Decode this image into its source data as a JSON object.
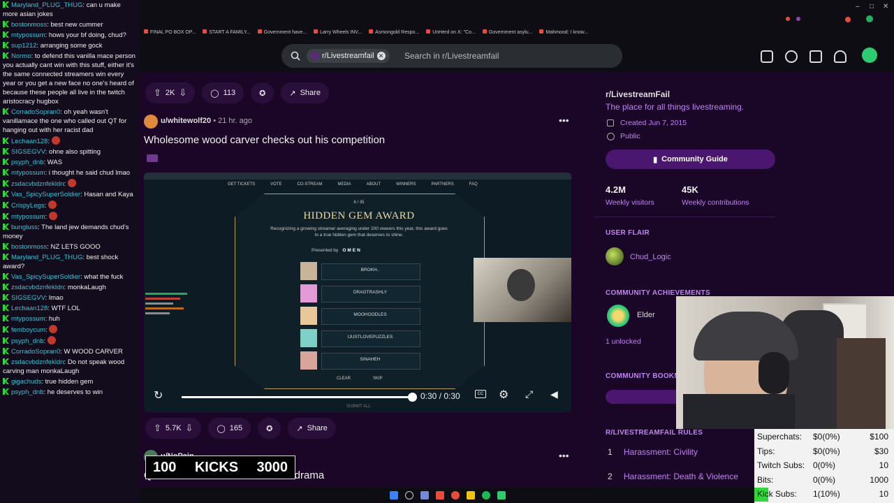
{
  "chat": {
    "messages": [
      {
        "user": "Maryland_PLUG_THUG",
        "text": "can u make more asian jokes"
      },
      {
        "user": "bostonmoss",
        "text": "best new cummer"
      },
      {
        "user": "mtypossum",
        "text": "hows your bf doing, chud?"
      },
      {
        "user": "sup1212",
        "text": "arranging some gock"
      },
      {
        "user": "Normo",
        "text": "to defend this vanilla mace person you actually cant win with this stuff, either it's the same connected streamers win every year or you get a new face no one's heard of because these people all live in the twitch aristocracy hugbox"
      },
      {
        "user": "CorradoSopran0",
        "text": "oh yeah wasn't vanillamace the one who called out QT for hanging out with her racist dad"
      },
      {
        "user": "Lechaan128",
        "text": ""
      },
      {
        "user": "SIGSEGVV",
        "text": "ohne also spitting"
      },
      {
        "user": "psyph_dnb",
        "text": "WAS"
      },
      {
        "user": "mtypossum",
        "text": "i thought he said chud lmao"
      },
      {
        "user": "zsdacvbdznfekldn",
        "text": ""
      },
      {
        "user": "Vas_SpicySuperSoldier",
        "text": "Hasan and Kaya"
      },
      {
        "user": "CrispyLegs",
        "text": ""
      },
      {
        "user": "mtypossum",
        "text": ""
      },
      {
        "user": "bungluss",
        "text": "The land jew demands chud's money"
      },
      {
        "user": "bostonmoss",
        "text": "NZ LETS GOOO"
      },
      {
        "user": "Maryland_PLUG_THUG",
        "text": "best shock award?"
      },
      {
        "user": "Vas_SpicySuperSoldier",
        "text": "what the fuck"
      },
      {
        "user": "zsdacvbdznfekldn",
        "text": "monkaLaugh"
      },
      {
        "user": "SIGSEGVV",
        "text": "lmao"
      },
      {
        "user": "Lechaan128",
        "text": "WTF LOL"
      },
      {
        "user": "mtypossum",
        "text": "huh"
      },
      {
        "user": "femboycum",
        "text": ""
      },
      {
        "user": "psyph_dnb",
        "text": ""
      },
      {
        "user": "CorradoSopran0",
        "text": "W WOOD CARVER"
      },
      {
        "user": "zsdacvbdznfekldn",
        "text": "Do not speak wood carving man monkaLaugh"
      },
      {
        "user": "gigachuds",
        "text": "true hidden gem"
      },
      {
        "user": "psyph_dnb",
        "text": "he deserves to win"
      }
    ]
  },
  "bookmarks": [
    "FINAL PO BOX OP...",
    "START A FAMILY...",
    "Government have...",
    "Larry Wheels INV...",
    "Asmongold Respo...",
    "UnHerd on X: \"Co...",
    "Government asylu...",
    "Mahmood: I know..."
  ],
  "header": {
    "search_chip": "r/Livestreamfail",
    "search_placeholder": "Search in r/Livestreamfail"
  },
  "post1_actions": {
    "votes": "2K",
    "comments": "113",
    "share": "Share"
  },
  "post2": {
    "author": "u/whitewolf20",
    "time": "21 hr. ago",
    "title": "Wholesome wood carver checks out his competition",
    "votes": "5.7K",
    "comments": "165",
    "share": "Share"
  },
  "video": {
    "nav": [
      "GET TICKETS",
      "VOTE",
      "CO-STREAM",
      "MEDIA",
      "ABOUT",
      "WINNERS",
      "PARTNERS",
      "FAQ"
    ],
    "counter": "6 / 35",
    "award_title": "HIDDEN GEM AWARD",
    "award_desc": "Recognizing a growing streamer averaging under 200 viewers this year, this award goes to a true hidden gem that deserves to shine.",
    "presented_by": "Presented by",
    "sponsor": "OMEN",
    "nominees": [
      "BROKH..",
      "DRAGTRASHLY",
      "MOOHOODLES",
      "IJUSTLOVEPUZZLES",
      "SINAHEH"
    ],
    "clear": "CLEAR",
    "skip": "SKIP",
    "submit": "SUBMIT ALL",
    "time": "0:30 / 0:30",
    "progress": 1.0
  },
  "post3": {
    "author": "u/NoPain",
    "title_partial": "Quins take on Streamer Awards drama"
  },
  "overlay_kicks": {
    "left": "100",
    "middle": "KICKS",
    "right": "3000"
  },
  "sidebar": {
    "name": "r/LivestreamFail",
    "desc": "The place for all things livestreaming.",
    "created": "Created Jun 7, 2015",
    "visibility": "Public",
    "guide_btn": "Community Guide",
    "visitors_num": "4.2M",
    "visitors_label": "Weekly visitors",
    "contrib_num": "45K",
    "contrib_label": "Weekly contributions",
    "flair_head": "USER FLAIR",
    "flair_name": "Chud_Logic",
    "ach_head": "COMMUNITY ACHIEVEMENTS",
    "ach_name": "Elder",
    "ach_unlocked": "1 unlocked",
    "bookmarks_head": "COMMUNITY BOOKM",
    "rules_head": "R/LIVESTREAMFAIL RULES",
    "rules": [
      {
        "num": "1",
        "text": "Harassment: Civility"
      },
      {
        "num": "2",
        "text": "Harassment: Death & Violence"
      }
    ]
  },
  "stats": [
    {
      "label": "Superchats:",
      "value": "$0(0%)",
      "max": "$100"
    },
    {
      "label": "Tips:",
      "value": "$0(0%)",
      "max": "$30"
    },
    {
      "label": "Twitch Subs:",
      "value": "0(0%)",
      "max": "10"
    },
    {
      "label": "Bits:",
      "value": "0(0%)",
      "max": "1000"
    },
    {
      "label": "Kick Subs:",
      "value": "1(10%)",
      "max": "10"
    }
  ],
  "colors": {
    "accent": "#c084f5",
    "chat_user": "#37c3d6",
    "kick_green": "#31d63b",
    "guide_btn": "#4a1670"
  }
}
